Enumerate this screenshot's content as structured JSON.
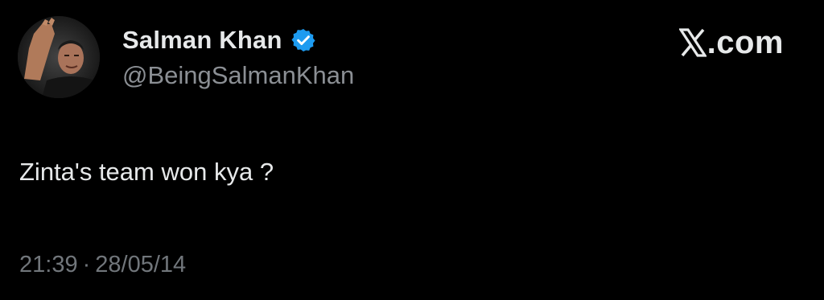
{
  "user": {
    "display_name": "Salman Khan",
    "handle": "@BeingSalmanKhan",
    "verified": true,
    "avatar_icon": "profile-photo-waving"
  },
  "brand": {
    "logo_icon": "x-logo-icon",
    "text": ".com"
  },
  "tweet": {
    "text": "Zinta's team won kya ?",
    "time": "21:39",
    "separator": "·",
    "date": "28/05/14"
  },
  "colors": {
    "background": "#000000",
    "primary_text": "#e7e9ea",
    "secondary_text": "#71767b",
    "verified_blue": "#1d9bf0"
  }
}
